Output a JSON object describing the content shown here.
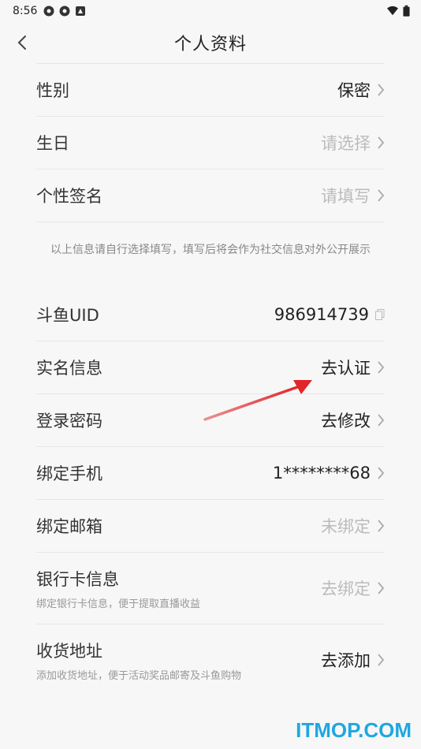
{
  "status_bar": {
    "time": "8:56",
    "icons": [
      "vpn-icon",
      "vpn-icon",
      "notification-icon"
    ],
    "right_icons": [
      "wifi-icon",
      "battery-icon"
    ]
  },
  "header": {
    "title": "个人资料",
    "back_icon": "back-icon"
  },
  "section1": {
    "rows": [
      {
        "label": "性别",
        "value": "保密",
        "placeholder": false
      },
      {
        "label": "生日",
        "value": "请选择",
        "placeholder": true
      },
      {
        "label": "个性签名",
        "value": "请填写",
        "placeholder": true
      }
    ],
    "notice": "以上信息请自行选择填写，填写后将会作为社交信息对外公开展示"
  },
  "section2": {
    "uid": {
      "label": "斗鱼UID",
      "value": "986914739"
    },
    "rows": [
      {
        "label": "实名信息",
        "value": "去认证",
        "placeholder": false
      },
      {
        "label": "登录密码",
        "value": "去修改",
        "placeholder": false
      },
      {
        "label": "绑定手机",
        "value": "1********68",
        "placeholder": false
      },
      {
        "label": "绑定邮箱",
        "value": "未绑定",
        "placeholder": true
      }
    ],
    "bank": {
      "label": "银行卡信息",
      "sub": "绑定银行卡信息，便于提取直播收益",
      "value": "去绑定",
      "placeholder": true
    },
    "address": {
      "label": "收货地址",
      "sub": "添加收货地址，便于活动奖品邮寄及斗鱼购物",
      "value": "去添加",
      "placeholder": false
    }
  },
  "annotation": {
    "arrow_color": "#e0262a"
  },
  "watermark": "ITMOP.COM",
  "colors": {
    "watermark": "#1fa7e0",
    "placeholder": "#bbbbbb"
  }
}
